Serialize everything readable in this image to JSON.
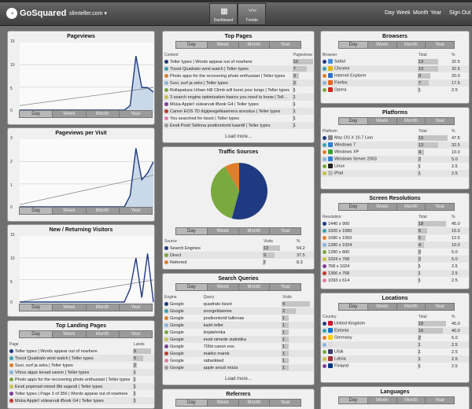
{
  "app": {
    "logo": "GoSquared",
    "site": "slimteller.com",
    "nav": [
      {
        "label": "Dashboard"
      },
      {
        "label": "Trends"
      }
    ],
    "periods": [
      "Day",
      "Week",
      "Month",
      "Year"
    ],
    "signout": "Sign Out"
  },
  "tabs": [
    "Day",
    "Week",
    "Month",
    "Year"
  ],
  "pageviews": {
    "title": "Pageviews",
    "y": [
      "15",
      "10",
      "5",
      "0"
    ]
  },
  "ppv": {
    "title": "Pageviews per Visit",
    "y": [
      "3",
      "2",
      "1",
      "0"
    ]
  },
  "nrv": {
    "title": "New / Returning Visitors",
    "y": [
      "15",
      "10",
      "5",
      "0"
    ]
  },
  "landing": {
    "title": "Top Landing Pages",
    "headers": [
      "Page",
      "Lands"
    ],
    "rows": [
      {
        "name": "Teller types | Words appear out of nowhere",
        "value": "9",
        "color": "#1f3a80",
        "w": 0.9
      },
      {
        "name": "Tissot Quadrato wrist watch | Teller types",
        "value": "5",
        "color": "#3aa0b0",
        "w": 0.5
      },
      {
        "name": "Suvi, surf ja seks | Teller types",
        "value": "2",
        "color": "#e07e2a",
        "w": 0.2
      },
      {
        "name": "Võrus algas kevad varem | Teller types",
        "value": "1",
        "color": "#8ab4d8",
        "w": 0.1
      },
      {
        "name": "Photo apps for the recovering photo enthusiast | Teller types",
        "value": "1",
        "color": "#7aa93e",
        "w": 0.1
      },
      {
        "name": "Eesti popimad nimed 8bi sajandi | Teller types",
        "value": "1",
        "color": "#c8c14a",
        "w": 0.1
      },
      {
        "name": "Teller types | Page 3 of 356 | Words appear out of nowhere",
        "value": "1",
        "color": "#7e3f98",
        "w": 0.1
      },
      {
        "name": "Müüa Apple'i sülearvuti iBook G4 | Teller types",
        "value": "1",
        "color": "#c0392b",
        "w": 0.1
      }
    ]
  },
  "toppages": {
    "title": "Top Pages",
    "headers": [
      "Content",
      "Pageviews"
    ],
    "rows": [
      {
        "name": "Teller types | Words appear out of nowhere",
        "value": "10",
        "color": "#1f3a80",
        "w": 1
      },
      {
        "name": "Tissot Quadrato wrist watch | Teller types",
        "value": "7",
        "color": "#3aa0b0",
        "w": 0.7
      },
      {
        "name": "Photo apps for the recovering photo enthusiast | Teller types",
        "value": "3",
        "color": "#e07e2a",
        "w": 0.3
      },
      {
        "name": "Suvi, surf ja seks | Teller types",
        "value": "2",
        "color": "#8ab4d8",
        "w": 0.2
      },
      {
        "name": "Rollapaluza Urban Hill Climb will burst your lungs | Teller types",
        "value": "1",
        "color": "#7aa93e",
        "w": 0.1
      },
      {
        "name": "3 search engine optimization basics you need to know | Teller types",
        "value": "1",
        "color": "#c8c14a",
        "w": 0.1
      },
      {
        "name": "Müüa Apple'i sülearvuti iBook G4 | Teller types",
        "value": "1",
        "color": "#7e3f98",
        "w": 0.1
      },
      {
        "name": "Canon EOS 7D digipeegelkaamera arvustus | Teller types",
        "value": "1",
        "color": "#c0392b",
        "w": 0.1
      },
      {
        "name": "You searched for tissot | Teller types",
        "value": "1",
        "color": "#e67aa8",
        "w": 0.1
      },
      {
        "name": "Eesti Posti Tallinna postkontorid kaardil | Teller types",
        "value": "1",
        "color": "#999999",
        "w": 0.1
      }
    ],
    "load": "Load more..."
  },
  "traffic": {
    "title": "Traffic Sources",
    "headers": [
      "Source",
      "Visits",
      "%"
    ],
    "rows": [
      {
        "name": "Search Engines",
        "value": "13",
        "pct": "54.2",
        "color": "#1f3a80",
        "w": 0.542
      },
      {
        "name": "Direct",
        "value": "9",
        "pct": "37.5",
        "color": "#7aa93e",
        "w": 0.375
      },
      {
        "name": "Referred",
        "value": "2",
        "pct": "8.3",
        "color": "#e07e2a",
        "w": 0.083
      }
    ]
  },
  "queries": {
    "title": "Search Queries",
    "headers": [
      "Engine",
      "Query",
      "Visits"
    ],
    "rows": [
      {
        "engine": "Google",
        "query": "quadrato tissot",
        "value": "4",
        "color": "#1f3a80",
        "w": 0.9
      },
      {
        "engine": "Google",
        "query": "snorgeldamine",
        "value": "2",
        "color": "#3aa0b0",
        "w": 0.45
      },
      {
        "engine": "Google",
        "query": "postkontorid tallinnas",
        "value": "1",
        "color": "#e07e2a",
        "w": 0.22
      },
      {
        "engine": "Google",
        "query": "kadri teller",
        "value": "1",
        "color": "#8ab4d8",
        "w": 0.22
      },
      {
        "engine": "Google",
        "query": "kirjatehnika",
        "value": "1",
        "color": "#7aa93e",
        "w": 0.22
      },
      {
        "engine": "Google",
        "query": "eesti nimede statistika",
        "value": "1",
        "color": "#c8c14a",
        "w": 0.22
      },
      {
        "engine": "Google",
        "query": "700d canon eos",
        "value": "1",
        "color": "#7e3f98",
        "w": 0.22
      },
      {
        "engine": "Google",
        "query": "makko marek",
        "value": "1",
        "color": "#c0392b",
        "w": 0.22
      },
      {
        "engine": "Google",
        "query": "rattarikked",
        "value": "1",
        "color": "#e67aa8",
        "w": 0.22
      },
      {
        "engine": "Google",
        "query": "apple arvuti müüa",
        "value": "1",
        "color": "#999999",
        "w": 0.22
      }
    ],
    "load": "Load more..."
  },
  "referrers": {
    "title": "Referrers"
  },
  "browsers": {
    "title": "Browsers",
    "headers": [
      "Browser",
      "Total",
      "%"
    ],
    "rows": [
      {
        "name": "Safari",
        "value": "13",
        "pct": "32.5",
        "color": "#1f3a80",
        "icon": "#4a90d9",
        "w": 0.65
      },
      {
        "name": "Chrome",
        "value": "13",
        "pct": "32.5",
        "color": "#3aa0b0",
        "icon": "#e5b400",
        "w": 0.65
      },
      {
        "name": "Internet Explorer",
        "value": "8",
        "pct": "20.0",
        "color": "#e07e2a",
        "icon": "#2a6fc9",
        "w": 0.4
      },
      {
        "name": "Firefox",
        "value": "7",
        "pct": "17.5",
        "color": "#8ab4d8",
        "icon": "#e8661c",
        "w": 0.35
      },
      {
        "name": "Opera",
        "value": "1",
        "pct": "2.5",
        "color": "#7aa93e",
        "icon": "#d0251f",
        "w": 0.05
      }
    ]
  },
  "platforms": {
    "title": "Platforms",
    "headers": [
      "Platform",
      "Total",
      "%"
    ],
    "rows": [
      {
        "name": "Mac OS X 10.7 Lion",
        "value": "19",
        "pct": "47.5",
        "color": "#1f3a80",
        "icon": "#888888",
        "w": 0.95
      },
      {
        "name": "Windows 7",
        "value": "13",
        "pct": "32.5",
        "color": "#3aa0b0",
        "icon": "#2f7fd1",
        "w": 0.65
      },
      {
        "name": "Windows XP",
        "value": "4",
        "pct": "10.0",
        "color": "#e07e2a",
        "icon": "#3aa03a",
        "w": 0.2
      },
      {
        "name": "Windows Server 2003",
        "value": "2",
        "pct": "5.0",
        "color": "#8ab4d8",
        "icon": "#2f7fd1",
        "w": 0.1
      },
      {
        "name": "Linux",
        "value": "1",
        "pct": "2.5",
        "color": "#7aa93e",
        "icon": "#222222",
        "w": 0.05
      },
      {
        "name": "iPad",
        "value": "1",
        "pct": "2.5",
        "color": "#c8c14a",
        "icon": "#bbbbbb",
        "w": 0.05
      }
    ]
  },
  "resolutions": {
    "title": "Screen Resolutions",
    "headers": [
      "Resolution",
      "Total",
      "%"
    ],
    "rows": [
      {
        "name": "1440 x 900",
        "value": "18",
        "pct": "45.0",
        "color": "#1f3a80",
        "w": 0.9
      },
      {
        "name": "1920 x 1080",
        "value": "6",
        "pct": "15.0",
        "color": "#3aa0b0",
        "w": 0.3
      },
      {
        "name": "1680 x 1050",
        "value": "5",
        "pct": "12.5",
        "color": "#e07e2a",
        "w": 0.25
      },
      {
        "name": "1280 x 1024",
        "value": "4",
        "pct": "10.0",
        "color": "#8ab4d8",
        "w": 0.2
      },
      {
        "name": "1280 x 800",
        "value": "2",
        "pct": "5.0",
        "color": "#7aa93e",
        "w": 0.1
      },
      {
        "name": "1024 x 768",
        "value": "2",
        "pct": "5.0",
        "color": "#c8c14a",
        "w": 0.1
      },
      {
        "name": "768 x 1024",
        "value": "1",
        "pct": "2.5",
        "color": "#7e3f98",
        "w": 0.05
      },
      {
        "name": "1366 x 768",
        "value": "1",
        "pct": "2.5",
        "color": "#c0392b",
        "w": 0.05
      },
      {
        "name": "1093 x 614",
        "value": "1",
        "pct": "2.5",
        "color": "#e67aa8",
        "w": 0.05
      }
    ]
  },
  "locations": {
    "title": "Locations",
    "headers": [
      "Country",
      "Total",
      "%"
    ],
    "rows": [
      {
        "name": "United Kingdom",
        "value": "18",
        "pct": "45.0",
        "color": "#1f3a80",
        "flag": "#cf142b",
        "w": 0.9
      },
      {
        "name": "Estonia",
        "value": "16",
        "pct": "40.0",
        "color": "#3aa0b0",
        "flag": "#0072ce",
        "w": 0.8
      },
      {
        "name": "Germany",
        "value": "2",
        "pct": "5.0",
        "color": "#e07e2a",
        "flag": "#ffce00",
        "w": 0.1
      },
      {
        "name": "",
        "value": "1",
        "pct": "2.5",
        "color": "#8ab4d8",
        "flag": "#dddddd",
        "w": 0.05
      },
      {
        "name": "USA",
        "value": "1",
        "pct": "2.5",
        "color": "#7aa93e",
        "flag": "#3c3b6e",
        "w": 0.05
      },
      {
        "name": "Latvia",
        "value": "1",
        "pct": "2.5",
        "color": "#c8c14a",
        "flag": "#9e3039",
        "w": 0.05
      },
      {
        "name": "Finland",
        "value": "1",
        "pct": "2.5",
        "color": "#7e3f98",
        "flag": "#003580",
        "w": 0.05
      }
    ]
  },
  "languages": {
    "title": "Languages"
  },
  "chart_data": [
    {
      "type": "area",
      "title": "Pageviews",
      "ylim": [
        0,
        15
      ],
      "x": [
        0,
        1,
        2,
        3,
        4,
        5,
        6,
        7,
        8,
        9,
        10,
        11,
        12,
        13,
        14,
        15,
        16,
        17,
        18,
        19,
        20,
        21,
        22,
        23
      ],
      "values": [
        0,
        0,
        0,
        0,
        0,
        0,
        0,
        0,
        0,
        0,
        0,
        0,
        0,
        0,
        0,
        0,
        0,
        0,
        0,
        1,
        12,
        5,
        5,
        4
      ],
      "trend": [
        1,
        5
      ]
    },
    {
      "type": "area",
      "title": "Pageviews per Visit",
      "ylim": [
        0,
        3
      ],
      "x": [
        0,
        1,
        2,
        3,
        4,
        5,
        6,
        7,
        8,
        9,
        10,
        11,
        12,
        13,
        14,
        15,
        16,
        17,
        18,
        19,
        20,
        21,
        22,
        23
      ],
      "values": [
        0,
        0,
        0,
        0,
        0,
        0,
        0,
        0,
        0,
        0,
        0,
        0,
        0,
        0,
        0,
        0,
        0,
        0,
        0,
        0.5,
        2.6,
        1.2,
        1.5,
        2
      ],
      "trend": [
        0.1,
        1.4
      ]
    },
    {
      "type": "line",
      "title": "New / Returning Visitors",
      "ylim": [
        0,
        15
      ],
      "x": [
        0,
        1,
        2,
        3,
        4,
        5,
        6,
        7,
        8,
        9,
        10,
        11,
        12,
        13,
        14,
        15,
        16,
        17,
        18,
        19,
        20,
        21,
        22,
        23
      ],
      "values": [
        0,
        0,
        0,
        0,
        0,
        0,
        0,
        0,
        0,
        0,
        0,
        0,
        0,
        0,
        0,
        0,
        0,
        0,
        0,
        3,
        10,
        1,
        11,
        0
      ],
      "trend": [
        0,
        5
      ]
    },
    {
      "type": "pie",
      "title": "Traffic Sources",
      "categories": [
        "Search Engines",
        "Direct",
        "Referred"
      ],
      "values": [
        54.2,
        37.5,
        8.3
      ],
      "colors": [
        "#1f3a80",
        "#7aa93e",
        "#e07e2a"
      ]
    }
  ]
}
